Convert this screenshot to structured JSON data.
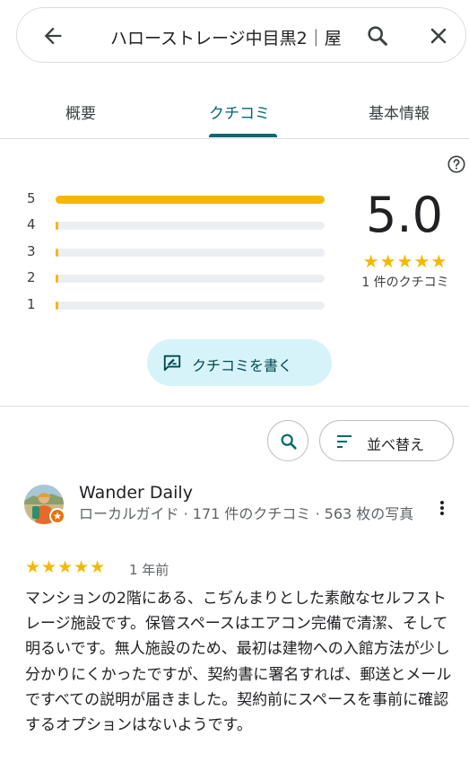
{
  "search": {
    "query": "ハローストレージ中目黒2｜屋"
  },
  "tabs": [
    {
      "label": "概要",
      "active": false
    },
    {
      "label": "クチコミ",
      "active": true
    },
    {
      "label": "基本情報",
      "active": false
    }
  ],
  "rating": {
    "distribution": [
      {
        "stars": "5",
        "fraction": 1.0
      },
      {
        "stars": "4",
        "fraction": 0.0
      },
      {
        "stars": "3",
        "fraction": 0.0
      },
      {
        "stars": "2",
        "fraction": 0.0
      },
      {
        "stars": "1",
        "fraction": 0.0
      }
    ],
    "score": "5.0",
    "stars": "★★★★★",
    "count_label": "1 件のクチコミ"
  },
  "write_review_label": "クチコミを書く",
  "sort_label": "並べ替え",
  "review": {
    "author": "Wander Daily",
    "meta": "ローカルガイド · 171 件のクチコミ · 563 枚の写真",
    "stars": "★★★★★",
    "time": "1 年前",
    "text": "マンションの2階にある、こぢんまりとした素敵なセルフストレージ施設です。保管スペースはエアコン完備で清潔、そして明るいです。無人施設のため、最初は建物への入館方法が少し分かりにくかったですが、契約書に署名すれば、郵送とメールですべての説明が届きました。契約前にスペースを事前に確認するオプションはないようです。"
  },
  "colors": {
    "accent": "#00686f",
    "star": "#f5b800",
    "button_bg": "#d7f3fa",
    "badge": "#e8710a"
  }
}
